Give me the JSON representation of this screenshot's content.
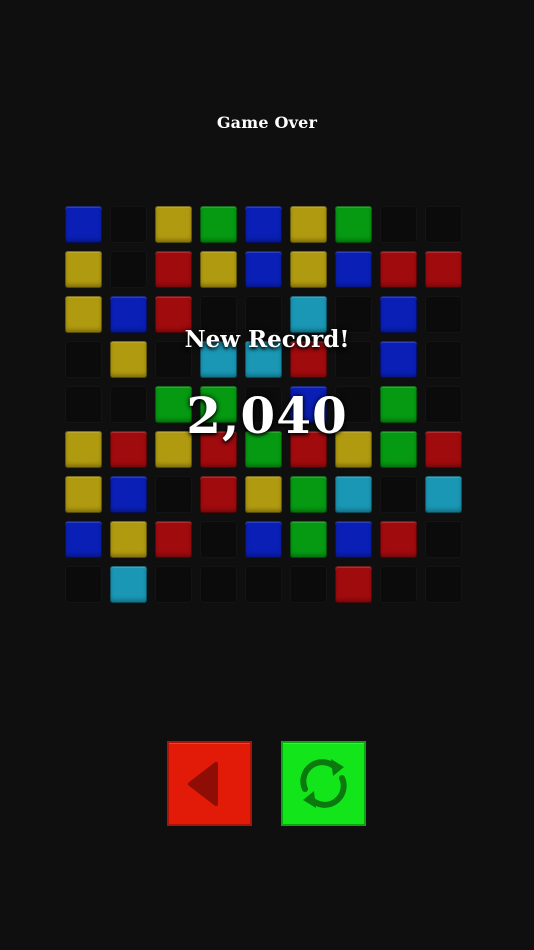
{
  "header": {
    "title": "Game Over"
  },
  "overlay": {
    "record_label": "New Record!",
    "score": "2,040"
  },
  "board": {
    "rows": 9,
    "cols": 9,
    "colors": {
      "blue": "#0a1fb6",
      "yellow": "#b09a10",
      "green": "#069a12",
      "red": "#a00b0e",
      "cyan": "#1a97b4"
    },
    "grid": [
      [
        "blue",
        "empty",
        "yellow",
        "green",
        "blue",
        "yellow",
        "green",
        "empty",
        "empty"
      ],
      [
        "yellow",
        "empty",
        "red",
        "yellow",
        "blue",
        "yellow",
        "blue",
        "red",
        "red"
      ],
      [
        "yellow",
        "blue",
        "red",
        "empty",
        "empty",
        "cyan",
        "empty",
        "blue",
        "empty"
      ],
      [
        "empty",
        "yellow",
        "empty",
        "cyan",
        "cyan",
        "red",
        "empty",
        "blue",
        "empty"
      ],
      [
        "empty",
        "empty",
        "green",
        "green",
        "empty",
        "blue",
        "empty",
        "green",
        "empty"
      ],
      [
        "yellow",
        "red",
        "yellow",
        "red",
        "green",
        "red",
        "yellow",
        "green",
        "red"
      ],
      [
        "yellow",
        "blue",
        "empty",
        "red",
        "yellow",
        "green",
        "cyan",
        "empty",
        "cyan"
      ],
      [
        "blue",
        "yellow",
        "red",
        "empty",
        "blue",
        "green",
        "blue",
        "red",
        "empty"
      ],
      [
        "empty",
        "cyan",
        "empty",
        "empty",
        "empty",
        "empty",
        "red",
        "empty",
        "empty"
      ]
    ]
  },
  "controls": {
    "back_icon": "back-arrow-icon",
    "back_color": "#e21b08",
    "restart_icon": "restart-icon",
    "restart_color": "#12e51a"
  }
}
